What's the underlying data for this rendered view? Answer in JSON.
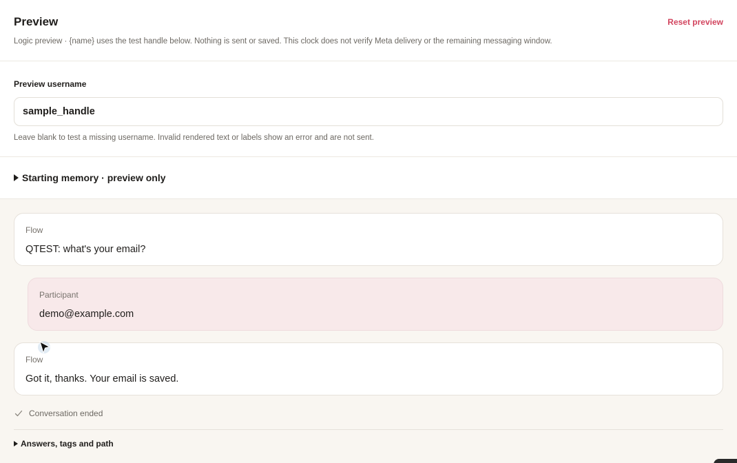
{
  "header": {
    "title": "Preview",
    "subtitle": "Logic preview · {name} uses the test handle below. Nothing is sent or saved. This clock does not verify Meta delivery or the remaining messaging window.",
    "reset_label": "Reset preview"
  },
  "username": {
    "label": "Preview username",
    "value": "sample_handle",
    "hint": "Leave blank to test a missing username. Invalid rendered text or labels show an error and are not sent."
  },
  "memory": {
    "label": "Starting memory · preview only"
  },
  "conversation": {
    "messages": [
      {
        "role": "Flow",
        "text": "QTEST: what's your email?"
      },
      {
        "role": "Participant",
        "text": "demo@example.com"
      },
      {
        "role": "Flow",
        "text": "Got it, thanks. Your email is saved."
      }
    ],
    "status": "Conversation ended",
    "answers_label": "Answers, tags and path"
  },
  "colors": {
    "accent": "#d2455f",
    "participant_bubble": "#f8e9ea",
    "conversation_bg": "#f9f6f1"
  },
  "icons": {
    "status": "check-icon",
    "disclosure": "triangle-right-icon",
    "pointer": "cursor-icon"
  }
}
